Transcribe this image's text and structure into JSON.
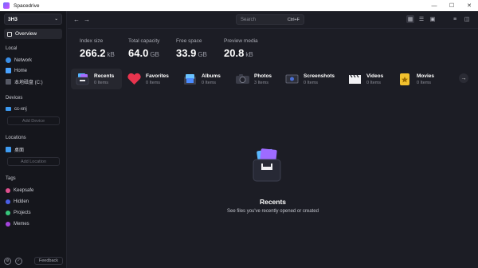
{
  "window": {
    "title": "Spacedrive",
    "controls": [
      "—",
      "☐",
      "✕"
    ]
  },
  "sidebar": {
    "library": "3H3",
    "overview": "Overview",
    "local_label": "Local",
    "local_items": [
      {
        "label": "Network",
        "icon": "network-icon"
      },
      {
        "label": "Home",
        "icon": "home-folder-icon"
      },
      {
        "label": "本地磁盘 (C:)",
        "icon": "drive-icon"
      }
    ],
    "devices_label": "Devices",
    "devices": [
      {
        "label": "cc-xnj",
        "icon": "laptop-icon"
      }
    ],
    "add_device": "Add Device",
    "locations_label": "Locations",
    "locations": [
      {
        "label": "桌面",
        "icon": "folder-icon"
      }
    ],
    "add_location": "Add Location",
    "tags_label": "Tags",
    "tags": [
      {
        "label": "Keepsafe",
        "color": "#e0508f"
      },
      {
        "label": "Hidden",
        "color": "#4a5ee6"
      },
      {
        "label": "Projects",
        "color": "#37c77c"
      },
      {
        "label": "Memes",
        "color": "#a444dd"
      }
    ],
    "feedback": "Feedback"
  },
  "topbar": {
    "search_placeholder": "Search",
    "search_shortcut": "Ctrl+F"
  },
  "stats": [
    {
      "label": "Index size",
      "value": "266.2",
      "unit": "kB"
    },
    {
      "label": "Total capacity",
      "value": "64.0",
      "unit": "GB"
    },
    {
      "label": "Free space",
      "value": "33.9",
      "unit": "GB"
    },
    {
      "label": "Preview media",
      "value": "20.8",
      "unit": "kB"
    }
  ],
  "categories": [
    {
      "name": "Recents",
      "count": "0 Items"
    },
    {
      "name": "Favorites",
      "count": "0 Items"
    },
    {
      "name": "Albums",
      "count": "0 Items"
    },
    {
      "name": "Photos",
      "count": "3 Items"
    },
    {
      "name": "Screenshots",
      "count": "0 Items"
    },
    {
      "name": "Videos",
      "count": "0 Items"
    },
    {
      "name": "Movies",
      "count": "0 Items"
    }
  ],
  "empty_state": {
    "title": "Recents",
    "subtitle": "See files you've recently opened or created"
  },
  "colors": {
    "background": "#1c1d25",
    "sidebar": "#15161c",
    "accent": "#2599ff"
  }
}
